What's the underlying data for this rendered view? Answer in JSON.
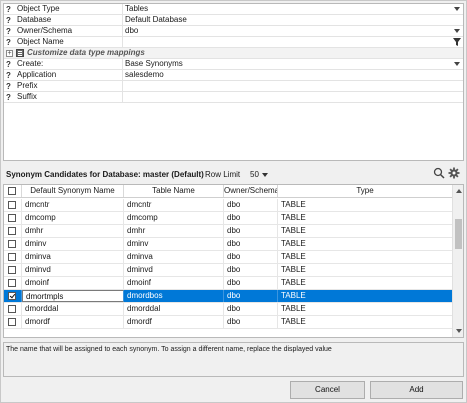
{
  "properties": {
    "rows": [
      {
        "name": "Object Type",
        "value": "Tables",
        "control": "dropdown"
      },
      {
        "name": "Database",
        "value": "Default Database",
        "control": "none"
      },
      {
        "name": "Owner/Schema",
        "value": "dbo",
        "control": "dropdown"
      },
      {
        "name": "Object Name",
        "value": "",
        "control": "filter"
      }
    ],
    "group": {
      "label": "Customize data type mappings"
    },
    "rows2": [
      {
        "name": "Create:",
        "value": "Base Synonyms",
        "control": "dropdown"
      },
      {
        "name": "Application",
        "value": "salesdemo",
        "control": "none"
      },
      {
        "name": "Prefix",
        "value": "",
        "control": "none"
      },
      {
        "name": "Suffix",
        "value": "",
        "control": "none"
      }
    ],
    "help_glyph": "?",
    "expander_glyph": "⊞"
  },
  "candidates": {
    "title": "Synonym Candidates for Database: master (Default)",
    "row_limit_label": "Row Limit",
    "row_limit_value": "50",
    "icons": [
      "search-icon",
      "gear-icon"
    ],
    "columns": [
      "",
      "Default Synonym Name",
      "Table Name",
      "Owner/Schema",
      "Type"
    ],
    "rows": [
      {
        "checked": false,
        "synonym": "dmcntr",
        "table": "dmcntr",
        "owner": "dbo",
        "type": "TABLE",
        "selected": false
      },
      {
        "checked": false,
        "synonym": "dmcomp",
        "table": "dmcomp",
        "owner": "dbo",
        "type": "TABLE",
        "selected": false
      },
      {
        "checked": false,
        "synonym": "dmhr",
        "table": "dmhr",
        "owner": "dbo",
        "type": "TABLE",
        "selected": false
      },
      {
        "checked": false,
        "synonym": "dminv",
        "table": "dminv",
        "owner": "dbo",
        "type": "TABLE",
        "selected": false
      },
      {
        "checked": false,
        "synonym": "dminva",
        "table": "dminva",
        "owner": "dbo",
        "type": "TABLE",
        "selected": false
      },
      {
        "checked": false,
        "synonym": "dminvd",
        "table": "dminvd",
        "owner": "dbo",
        "type": "TABLE",
        "selected": false
      },
      {
        "checked": false,
        "synonym": "dmoinf",
        "table": "dmoinf",
        "owner": "dbo",
        "type": "TABLE",
        "selected": false
      },
      {
        "checked": true,
        "synonym": "dmortmpls",
        "table": "dmordbos",
        "owner": "dbo",
        "type": "TABLE",
        "selected": true
      },
      {
        "checked": false,
        "synonym": "dmorddal",
        "table": "dmorddal",
        "owner": "dbo",
        "type": "TABLE",
        "selected": false
      },
      {
        "checked": false,
        "synonym": "dmordf",
        "table": "dmordf",
        "owner": "dbo",
        "type": "TABLE",
        "selected": false
      }
    ]
  },
  "description": "The name that will be assigned to each synonym. To assign a different name, replace the displayed value",
  "buttons": {
    "cancel": "Cancel",
    "add": "Add"
  },
  "colors": {
    "selection": "#0078d7",
    "border": "#b9b9b9"
  }
}
